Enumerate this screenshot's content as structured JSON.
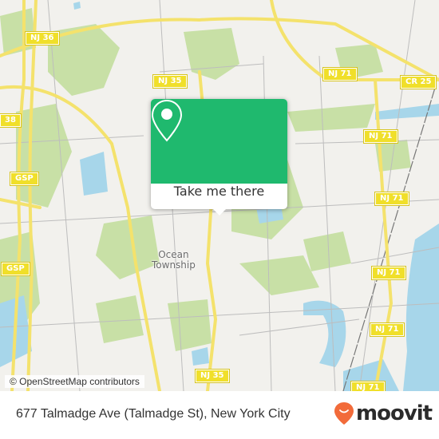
{
  "map": {
    "place_label": [
      "Ocean",
      "Township"
    ],
    "road_shields": [
      {
        "id": "nj36",
        "text": "NJ 36"
      },
      {
        "id": "nj35-top",
        "text": "NJ 35"
      },
      {
        "id": "nj71-top",
        "text": "NJ 71"
      },
      {
        "id": "cr25",
        "text": "CR 25"
      },
      {
        "id": "nj71-a",
        "text": "NJ 71"
      },
      {
        "id": "nj71-b",
        "text": "NJ 71"
      },
      {
        "id": "nj71-c",
        "text": "NJ 71"
      },
      {
        "id": "nj71-d",
        "text": "NJ 71"
      },
      {
        "id": "nj71-e",
        "text": "NJ 71"
      },
      {
        "id": "nj71-f",
        "text": "NJ 71"
      },
      {
        "id": "r38",
        "text": "38"
      },
      {
        "id": "gsp-1",
        "text": "GSP"
      },
      {
        "id": "gsp-2",
        "text": "GSP"
      },
      {
        "id": "nj35-bottom",
        "text": "NJ 35"
      }
    ],
    "attribution": "© OpenStreetMap contributors",
    "colors": {
      "land": "#f2f1ed",
      "park": "#c8e0a6",
      "water": "#a7d6ea",
      "road": "#f4e26c",
      "minor_road": "#bdbdbd"
    }
  },
  "popup": {
    "icon": "map-pin-icon",
    "button_label": "Take me there",
    "color": "#1fb96e"
  },
  "footer": {
    "address": "677 Talmadge Ave (Talmadge St), New York City",
    "brand": "moovit",
    "brand_color": "#f26b3a"
  }
}
